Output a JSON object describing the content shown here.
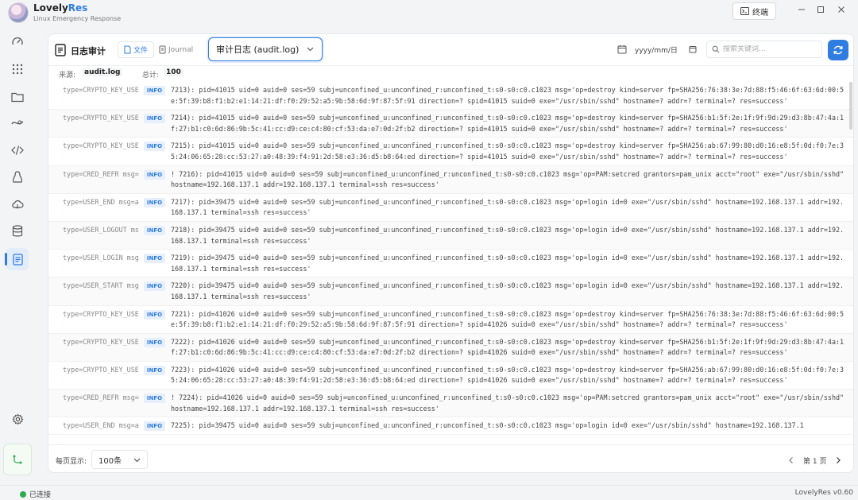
{
  "app": {
    "name_main": "Lovely",
    "name_accent": "Res",
    "subtitle": "Linux Emergency Response",
    "terminal_label": "终端",
    "accent_color": "#2f7de1"
  },
  "sidebar": {
    "items": [
      {
        "icon": "dashboard-gauge-icon"
      },
      {
        "icon": "apps-grid-icon"
      },
      {
        "icon": "folder-icon"
      },
      {
        "icon": "network-icon"
      },
      {
        "icon": "code-icon"
      },
      {
        "icon": "linux-penguin-icon"
      },
      {
        "icon": "cloud-icon"
      },
      {
        "icon": "database-icon"
      },
      {
        "icon": "document-log-icon",
        "active": true
      }
    ],
    "settings_icon": "gear-icon",
    "bottom_icon": "connection-icon"
  },
  "toolbar": {
    "title": "日志审计",
    "tab_file": "文件",
    "tab_journal": "Journal",
    "log_select": "审计日志 (audit.log)",
    "date_placeholder": "yyyy/mm/日",
    "search_placeholder": "搜索关键词..."
  },
  "info": {
    "source_label": "来源:",
    "source_value": "audit.log",
    "total_label": "总计:",
    "total_value": "100"
  },
  "logs": [
    {
      "type": "type=CRYPTO_KEY_USE",
      "level": "INFO",
      "message": "7213): pid=41015 uid=0 auid=0 ses=59 subj=unconfined_u:unconfined_r:unconfined_t:s0-s0:c0.c1023 msg='op=destroy kind=server fp=SHA256:76:38:3e:7d:88:f5:46:6f:63:6d:00:5e:5f:39:b8:f1:b2:e1:14:21:df:f0:29:52:a5:9b:58:6d:9f:87:5f:91 direction=? spid=41015 suid=0  exe=\"/usr/sbin/sshd\" hostname=? addr=? terminal=? res=success'"
    },
    {
      "type": "type=CRYPTO_KEY_USE",
      "level": "INFO",
      "message": "7214): pid=41015 uid=0 auid=0 ses=59 subj=unconfined_u:unconfined_r:unconfined_t:s0-s0:c0.c1023 msg='op=destroy kind=server fp=SHA256:b1:5f:2e:1f:9f:9d:29:d3:8b:47:4a:1f:27:b1:c0:6d:86:9b:5c:41:cc:d9:ce:c4:80:cf:53:da:e7:0d:2f:b2 direction=? spid=41015 suid=0  exe=\"/usr/sbin/sshd\" hostname=? addr=? terminal=? res=success'"
    },
    {
      "type": "type=CRYPTO_KEY_USE",
      "level": "INFO",
      "message": "7215): pid=41015 uid=0 auid=0 ses=59 subj=unconfined_u:unconfined_r:unconfined_t:s0-s0:c0.c1023 msg='op=destroy kind=server fp=SHA256:ab:67:99:80:d0:16:e8:5f:0d:f0:7e:35:24:06:65:28:cc:53:27:a0:48:39:f4:91:2d:58:e3:36:d5:b8:64:ed direction=? spid=41015 suid=0  exe=\"/usr/sbin/sshd\" hostname=? addr=? terminal=? res=success'"
    },
    {
      "type": "type=CRED_REFR msg=",
      "level": "INFO",
      "message": "! 7216): pid=41015 uid=0 auid=0 ses=59 subj=unconfined_u:unconfined_r:unconfined_t:s0-s0:c0.c1023 msg='op=PAM:setcred grantors=pam_unix acct=\"root\" exe=\"/usr/sbin/sshd\" hostname=192.168.137.1 addr=192.168.137.1 terminal=ssh res=success'"
    },
    {
      "type": "type=USER_END msg=a",
      "level": "INFO",
      "message": "7217): pid=39475 uid=0 auid=0 ses=59 subj=unconfined_u:unconfined_r:unconfined_t:s0-s0:c0.c1023 msg='op=login id=0 exe=\"/usr/sbin/sshd\" hostname=192.168.137.1 addr=192.168.137.1 terminal=ssh res=success'"
    },
    {
      "type": "type=USER_LOGOUT ms",
      "level": "INFO",
      "message": "7218): pid=39475 uid=0 auid=0 ses=59 subj=unconfined_u:unconfined_r:unconfined_t:s0-s0:c0.c1023 msg='op=login id=0 exe=\"/usr/sbin/sshd\" hostname=192.168.137.1 addr=192.168.137.1 terminal=ssh res=success'"
    },
    {
      "type": "type=USER_LOGIN msg",
      "level": "INFO",
      "message": "7219): pid=39475 uid=0 auid=0 ses=59 subj=unconfined_u:unconfined_r:unconfined_t:s0-s0:c0.c1023 msg='op=login id=0 exe=\"/usr/sbin/sshd\" hostname=192.168.137.1 addr=192.168.137.1 terminal=ssh res=success'"
    },
    {
      "type": "type=USER_START msg",
      "level": "INFO",
      "message": "7220): pid=39475 uid=0 auid=0 ses=59 subj=unconfined_u:unconfined_r:unconfined_t:s0-s0:c0.c1023 msg='op=login id=0 exe=\"/usr/sbin/sshd\" hostname=192.168.137.1 addr=192.168.137.1 terminal=ssh res=success'"
    },
    {
      "type": "type=CRYPTO_KEY_USE",
      "level": "INFO",
      "message": "7221): pid=41026 uid=0 auid=0 ses=59 subj=unconfined_u:unconfined_r:unconfined_t:s0-s0:c0.c1023 msg='op=destroy kind=server fp=SHA256:76:38:3e:7d:88:f5:46:6f:63:6d:00:5e:5f:39:b8:f1:b2:e1:14:21:df:f0:29:52:a5:9b:58:6d:9f:87:5f:91 direction=? spid=41026 suid=0  exe=\"/usr/sbin/sshd\" hostname=? addr=? terminal=? res=success'"
    },
    {
      "type": "type=CRYPTO_KEY_USE",
      "level": "INFO",
      "message": "7222): pid=41026 uid=0 auid=0 ses=59 subj=unconfined_u:unconfined_r:unconfined_t:s0-s0:c0.c1023 msg='op=destroy kind=server fp=SHA256:b1:5f:2e:1f:9f:9d:29:d3:8b:47:4a:1f:27:b1:c0:6d:86:9b:5c:41:cc:d9:ce:c4:80:cf:53:da:e7:0d:2f:b2 direction=? spid=41026 suid=0  exe=\"/usr/sbin/sshd\" hostname=? addr=? terminal=? res=success'"
    },
    {
      "type": "type=CRYPTO_KEY_USE",
      "level": "INFO",
      "message": "7223): pid=41026 uid=0 auid=0 ses=59 subj=unconfined_u:unconfined_r:unconfined_t:s0-s0:c0.c1023 msg='op=destroy kind=server fp=SHA256:ab:67:99:80:d0:16:e8:5f:0d:f0:7e:35:24:06:65:28:cc:53:27:a0:48:39:f4:91:2d:58:e3:36:d5:b8:64:ed direction=? spid=41026 suid=0  exe=\"/usr/sbin/sshd\" hostname=? addr=? terminal=? res=success'"
    },
    {
      "type": "type=CRED_REFR msg=",
      "level": "INFO",
      "message": "! 7224): pid=41026 uid=0 auid=0 ses=59 subj=unconfined_u:unconfined_r:unconfined_t:s0-s0:c0.c1023 msg='op=PAM:setcred grantors=pam_unix acct=\"root\" exe=\"/usr/sbin/sshd\" hostname=192.168.137.1 addr=192.168.137.1 terminal=ssh res=success'"
    },
    {
      "type": "type=USER_END msg=a",
      "level": "INFO",
      "message": "7225): pid=39475 uid=0 auid=0 ses=59 subj=unconfined_u:unconfined_r:unconfined_t:s0-s0:c0.c1023 msg='op=login id=0 exe=\"/usr/sbin/sshd\" hostname=192.168.137.1"
    }
  ],
  "footer": {
    "per_page_label": "每页显示:",
    "per_page_value": "100条",
    "page_label": "第 1 页"
  },
  "status": {
    "connection": "已连接",
    "version": "LovelyRes v0.60",
    "connected_color": "#2eaa4f"
  }
}
